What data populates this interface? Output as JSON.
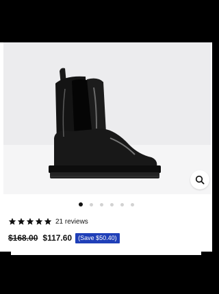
{
  "product": {
    "image_alt": "Black chelsea rain boot",
    "rating": {
      "stars": 5,
      "reviews_label": "21 reviews"
    },
    "price": {
      "original": "$168.00",
      "sale": "$117.60",
      "save_badge": "(Save $50.40)"
    },
    "carousel": {
      "total": 6,
      "active_index": 0
    }
  },
  "colors": {
    "badge": "#1f3fb8",
    "image_background": "#ececee",
    "text": "#111111"
  },
  "icons": {
    "zoom": "magnifier-icon",
    "star": "star-icon"
  }
}
